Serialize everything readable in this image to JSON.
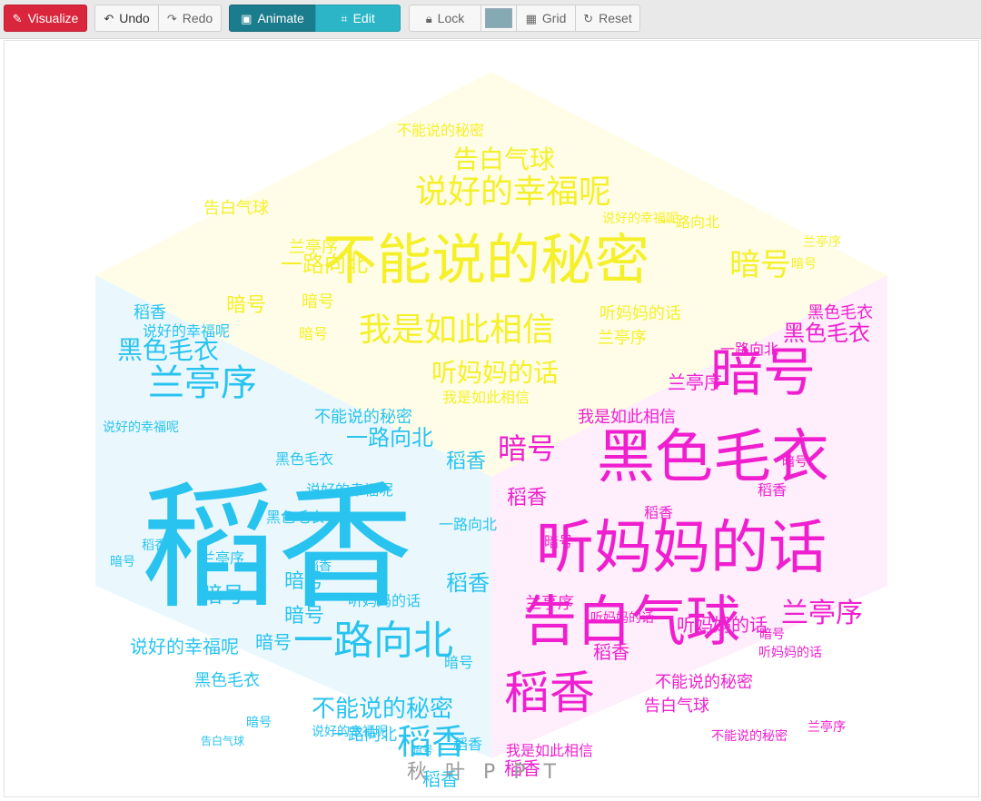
{
  "toolbar": {
    "visualize": "Visualize",
    "undo": "Undo",
    "redo": "Redo",
    "animate": "Animate",
    "edit": "Edit",
    "lock": "Lock",
    "grid": "Grid",
    "reset": "Reset",
    "swatch_color": "#86aab3"
  },
  "colors": {
    "yellow": "#f5f02a",
    "magenta": "#ef1fcf",
    "blue": "#29c3f0",
    "yellow_bg": "#fffde8",
    "magenta_bg": "#ffeefb",
    "blue_bg": "#eaf8fe"
  },
  "cloud": {
    "yellow": [
      "不能说的秘密",
      "说好的幸福呢",
      "我是如此相信",
      "暗号",
      "告白气球",
      "听妈妈的话",
      "一路向北",
      "兰亭序",
      "暗号",
      "告白气球",
      "暗号",
      "暗号",
      "听妈妈的话",
      "我是如此相信",
      "不能说的秘密",
      "说好的幸福呢",
      "兰亭序",
      "一路向北",
      "暗号",
      "兰亭序"
    ],
    "blue": [
      "稻香",
      "一路向北",
      "兰亭序",
      "黑色毛衣",
      "不能说的秘密",
      "稻香",
      "稻香",
      "暗号",
      "暗号",
      "暗号",
      "说好的幸福呢",
      "说好的幸福呢",
      "听妈妈的话",
      "黑色毛衣",
      "稻香",
      "暗号",
      "暗号",
      "稻香",
      "说好的幸福呢",
      "暗号",
      "稻香",
      "一路向北",
      "不能说的秘密",
      "一路向北",
      "黑色毛衣",
      "兰亭序",
      "说好的幸福呢",
      "告白气球",
      "稻香",
      "暗号",
      "稻香",
      "说好的幸福呢",
      "一路向北",
      "黑色毛衣",
      "暗号",
      "稻香"
    ],
    "magenta": [
      "黑色毛衣",
      "听妈妈的话",
      "告白气球",
      "稻香",
      "暗号",
      "兰亭序",
      "暗号",
      "稻香",
      "黑色毛衣",
      "黑色毛衣",
      "听妈妈的话",
      "兰亭序",
      "我是如此相信",
      "一路向北",
      "不能说的秘密",
      "告白气球",
      "兰亭序",
      "暗号",
      "稻香",
      "稻香",
      "听妈妈的话",
      "兰亭序",
      "听妈妈的话",
      "我是如此相信",
      "不能说的秘密",
      "稻香",
      "暗号",
      "暗号",
      "稻香"
    ]
  },
  "watermark": "秋叶PPT"
}
